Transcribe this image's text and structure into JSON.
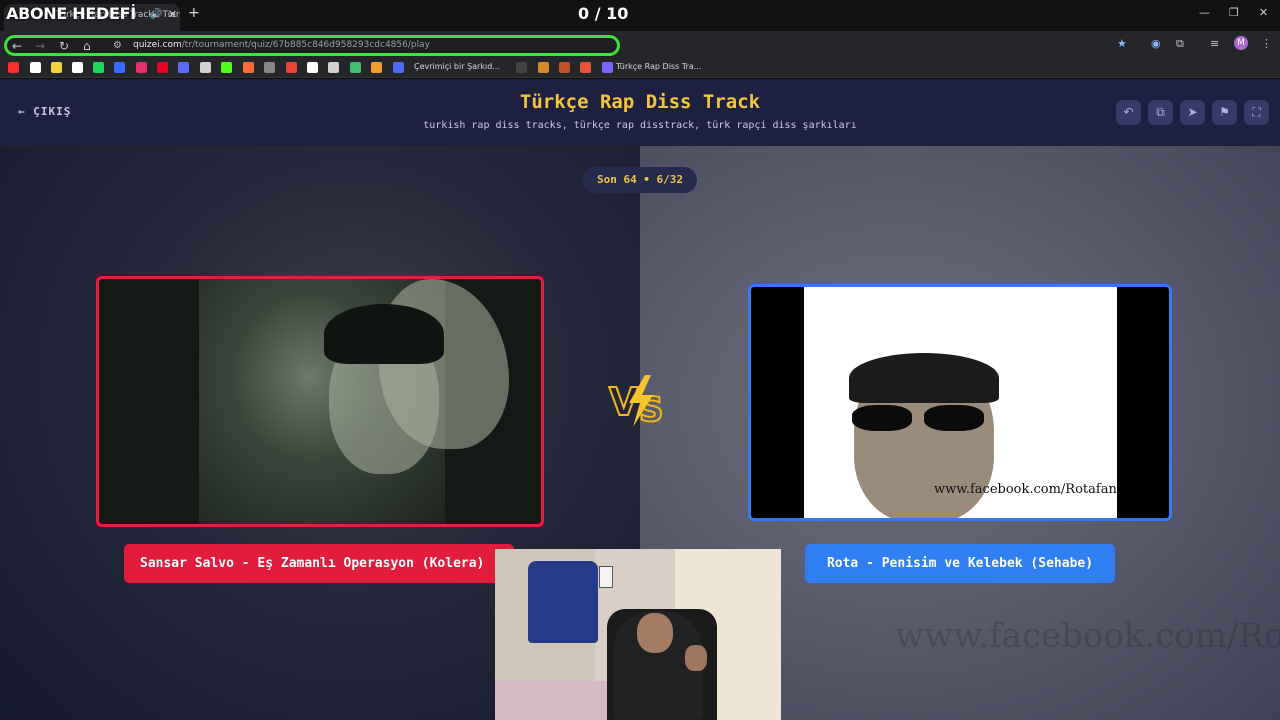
{
  "overlay": {
    "goal_label": "ABONE HEDEFİ",
    "counter": "0 / 10"
  },
  "browser": {
    "tab_title": "Türkçe Rap Diss Track - Tier",
    "url_domain": "quizei.com",
    "url_path": "/tr/tournament/quiz/67b885c846d958293cdc4856/play",
    "bookmarks": [
      {
        "icon": "youtube-icon",
        "color": "#ff2d2d"
      },
      {
        "icon": "tiktok-icon",
        "color": "#ffffff"
      },
      {
        "icon": "s-icon",
        "color": "#f5d33a"
      },
      {
        "icon": "x-icon",
        "color": "#ffffff"
      },
      {
        "icon": "spotify-icon",
        "color": "#1ed760"
      },
      {
        "icon": "bookmark-icon-6",
        "color": "#3a6bff"
      },
      {
        "icon": "instagram-icon",
        "color": "#e1306c"
      },
      {
        "icon": "pinterest-icon",
        "color": "#e60023"
      },
      {
        "icon": "bookmark-icon-9",
        "color": "#5c6bff"
      },
      {
        "icon": "bookmark-icon-10",
        "color": "#d0d0d0"
      },
      {
        "icon": "kick-icon",
        "color": "#53fc18"
      },
      {
        "icon": "bookmark-icon-12",
        "color": "#ff6b35"
      },
      {
        "icon": "bookmark-icon-13",
        "color": "#888888"
      },
      {
        "icon": "gmail-icon",
        "color": "#ea4335"
      },
      {
        "icon": "bookmark-icon-15",
        "color": "#ffffff"
      },
      {
        "icon": "bookmark-icon-16",
        "color": "#d0d0d0"
      },
      {
        "icon": "bookmark-icon-17",
        "color": "#3fbf6f"
      },
      {
        "icon": "bookmark-icon-18",
        "color": "#f0a030"
      },
      {
        "icon": "bookmark-icon-19",
        "color": "#4a6cf7"
      }
    ],
    "bookmark_text_1": "Çevrimiçi bir Şarkıd...",
    "bookmark_text_2": "Türkçe Rap Diss Tra..."
  },
  "header": {
    "exit_label": "ÇIKIŞ",
    "title": "Türkçe Rap Diss Track",
    "subtitle": "turkish rap diss tracks, türkçe rap disstrack, türk rapçi diss şarkıları"
  },
  "round": {
    "label": "Son 64 • 6/32"
  },
  "match": {
    "left": {
      "label": "Sansar Salvo - Eş Zamanlı Operasyon (Kolera)",
      "accent": "#e11c3d"
    },
    "right": {
      "label": "Rota - Penisim ve Kelebek (Sehabe)",
      "image_caption": "www.facebook.com/Rotafan",
      "accent": "#2f7ef2"
    },
    "vs_label": "VS"
  },
  "background_watermark": "www.facebook.com/Rotafan"
}
